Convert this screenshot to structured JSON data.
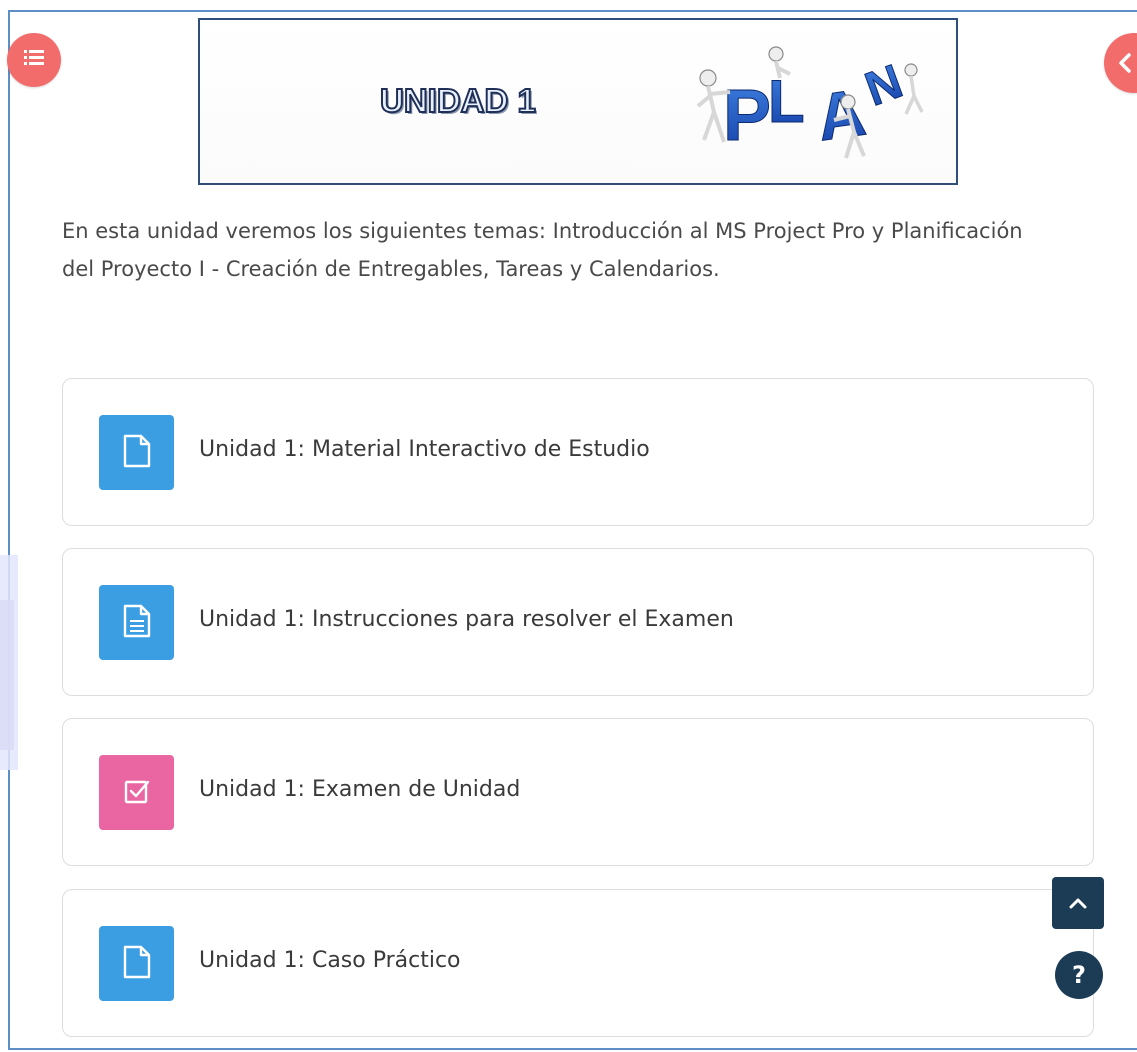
{
  "banner": {
    "title": "UNIDAD 1",
    "art_text": "PLAN"
  },
  "intro_text": "En esta unidad veremos los siguientes temas: Introducción al MS Project Pro y Planificación del Proyecto I - Creación de Entregables, Tareas y Calendarios.",
  "activities": [
    {
      "label": "Unidad 1: Material Interactivo de Estudio",
      "icon": "file-icon",
      "color": "#3b9ee2"
    },
    {
      "label": "Unidad 1: Instrucciones para resolver el Examen",
      "icon": "file-lines-icon",
      "color": "#3b9ee2"
    },
    {
      "label": "Unidad 1: Examen de Unidad",
      "icon": "checkbox-icon",
      "color": "#e966a2"
    },
    {
      "label": "Unidad 1: Caso Práctico",
      "icon": "file-icon",
      "color": "#3b9ee2"
    }
  ],
  "floating": {
    "help_label": "?"
  },
  "colors": {
    "drawer_button": "#f26c6c",
    "floating_button": "#1c3b55",
    "frame_border": "#5d8fc6"
  }
}
